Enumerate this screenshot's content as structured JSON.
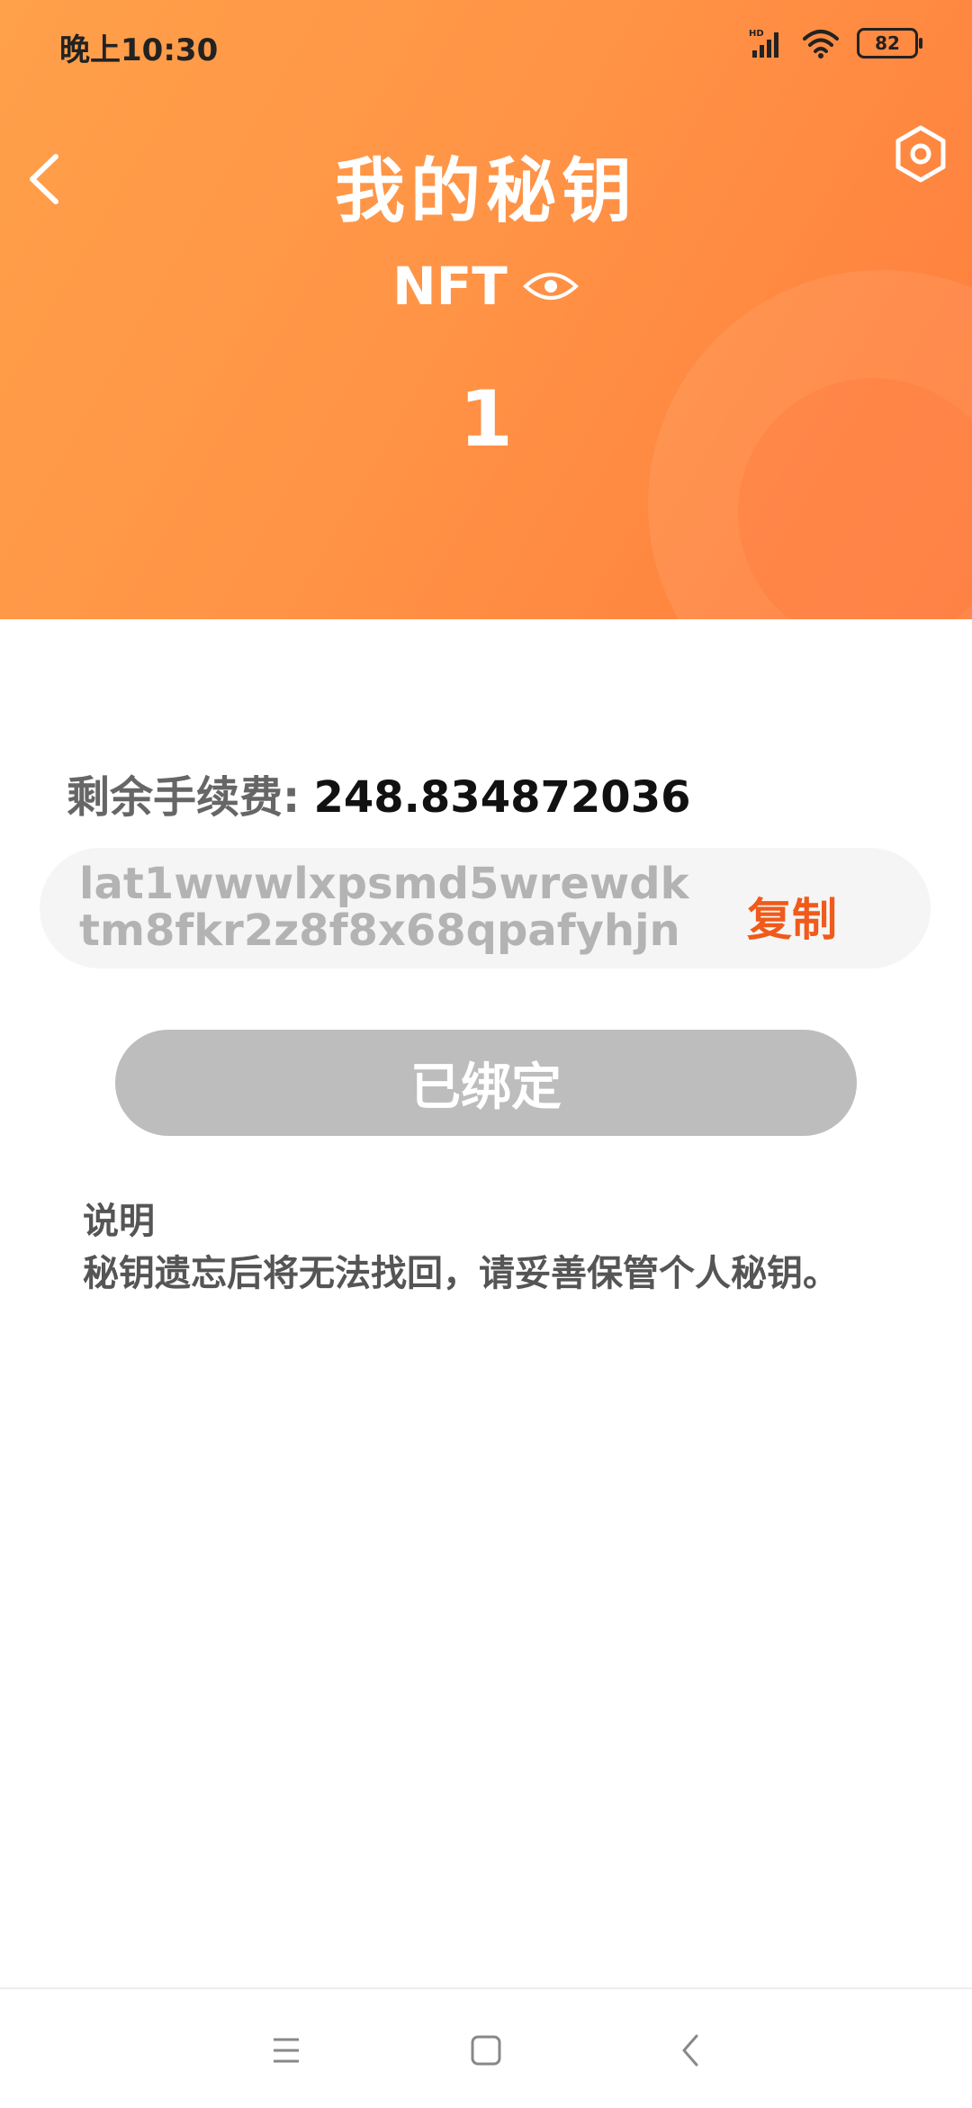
{
  "status_bar": {
    "time": "晚上10:30",
    "battery": "82"
  },
  "header": {
    "title": "我的秘钥",
    "asset_label": "NFT",
    "count": "1"
  },
  "fee": {
    "label": "剩余手续费:",
    "value": "248.834872036"
  },
  "address": {
    "value": "lat1wwwlxpsmd5wrewdktm8fkr2z8f8x68qpafyhjn",
    "copy_label": "复制"
  },
  "bind_button": {
    "label": "已绑定"
  },
  "note": {
    "title": "说明",
    "body": "秘钥遗忘后将无法找回，请妥善保管个人秘钥。"
  },
  "colors": {
    "header_gradient_start": "#ffa04a",
    "header_gradient_end": "#ff7d3c",
    "accent": "#f05a1a",
    "disabled_button": "#bdbdbd"
  },
  "icons": [
    "back-icon",
    "settings-icon",
    "eye-icon",
    "signal-icon",
    "wifi-icon",
    "battery-icon",
    "menu-icon",
    "home-icon",
    "nav-back-icon"
  ]
}
